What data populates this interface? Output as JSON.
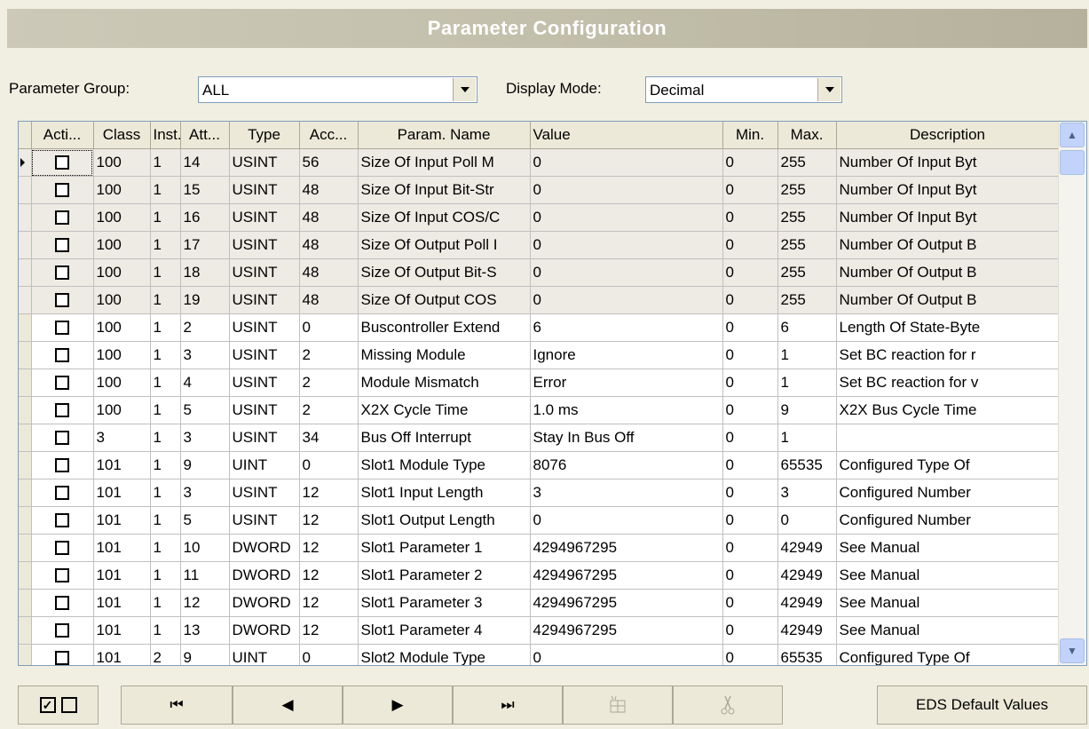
{
  "title": "Parameter Configuration",
  "controls": {
    "group_label": "Parameter Group:",
    "group_value": "ALL",
    "mode_label": "Display Mode:",
    "mode_value": "Decimal"
  },
  "columns": [
    "Acti...",
    "Class",
    "Inst...",
    "Att...",
    "Type",
    "Acc...",
    "Param. Name",
    "Value",
    "Min.",
    "Max.",
    "Description"
  ],
  "rows": [
    {
      "class": "100",
      "inst": "1",
      "att": "14",
      "type": "USINT",
      "acc": "56",
      "name": "Size Of Input Poll M",
      "value": "0",
      "min": "0",
      "max": "255",
      "desc": "Number Of Input Byt"
    },
    {
      "class": "100",
      "inst": "1",
      "att": "15",
      "type": "USINT",
      "acc": "48",
      "name": "Size Of Input Bit-Str",
      "value": "0",
      "min": "0",
      "max": "255",
      "desc": "Number Of Input Byt"
    },
    {
      "class": "100",
      "inst": "1",
      "att": "16",
      "type": "USINT",
      "acc": "48",
      "name": "Size Of Input COS/C",
      "value": "0",
      "min": "0",
      "max": "255",
      "desc": "Number Of Input Byt"
    },
    {
      "class": "100",
      "inst": "1",
      "att": "17",
      "type": "USINT",
      "acc": "48",
      "name": "Size Of Output Poll I",
      "value": "0",
      "min": "0",
      "max": "255",
      "desc": "Number Of Output B"
    },
    {
      "class": "100",
      "inst": "1",
      "att": "18",
      "type": "USINT",
      "acc": "48",
      "name": "Size Of Output Bit-S",
      "value": "0",
      "min": "0",
      "max": "255",
      "desc": "Number Of Output B"
    },
    {
      "class": "100",
      "inst": "1",
      "att": "19",
      "type": "USINT",
      "acc": "48",
      "name": "Size Of Output COS",
      "value": "0",
      "min": "0",
      "max": "255",
      "desc": "Number Of Output B"
    },
    {
      "class": "100",
      "inst": "1",
      "att": "2",
      "type": "USINT",
      "acc": "0",
      "name": "Buscontroller Extend",
      "value": "6",
      "min": "0",
      "max": "6",
      "desc": "Length Of State-Byte"
    },
    {
      "class": "100",
      "inst": "1",
      "att": "3",
      "type": "USINT",
      "acc": "2",
      "name": "Missing Module",
      "value": "Ignore",
      "min": "0",
      "max": "1",
      "desc": "Set BC reaction for r"
    },
    {
      "class": "100",
      "inst": "1",
      "att": "4",
      "type": "USINT",
      "acc": "2",
      "name": "Module Mismatch",
      "value": "Error",
      "min": "0",
      "max": "1",
      "desc": "Set BC reaction for v"
    },
    {
      "class": "100",
      "inst": "1",
      "att": "5",
      "type": "USINT",
      "acc": "2",
      "name": "X2X Cycle Time",
      "value": "1.0 ms",
      "min": "0",
      "max": "9",
      "desc": "X2X Bus Cycle Time"
    },
    {
      "class": "3",
      "inst": "1",
      "att": "3",
      "type": "USINT",
      "acc": "34",
      "name": "Bus Off Interrupt",
      "value": "Stay In Bus Off",
      "min": "0",
      "max": "1",
      "desc": ""
    },
    {
      "class": "101",
      "inst": "1",
      "att": "9",
      "type": "UINT",
      "acc": "0",
      "name": "Slot1 Module Type",
      "value": "8076",
      "min": "0",
      "max": "65535",
      "desc": "Configured Type Of"
    },
    {
      "class": "101",
      "inst": "1",
      "att": "3",
      "type": "USINT",
      "acc": "12",
      "name": "Slot1 Input Length",
      "value": "3",
      "min": "0",
      "max": "3",
      "desc": "Configured Number"
    },
    {
      "class": "101",
      "inst": "1",
      "att": "5",
      "type": "USINT",
      "acc": "12",
      "name": "Slot1 Output Length",
      "value": "0",
      "min": "0",
      "max": "0",
      "desc": "Configured Number"
    },
    {
      "class": "101",
      "inst": "1",
      "att": "10",
      "type": "DWORD",
      "acc": "12",
      "name": "Slot1 Parameter 1",
      "value": "4294967295",
      "min": "0",
      "max": "42949",
      "desc": "See Manual"
    },
    {
      "class": "101",
      "inst": "1",
      "att": "11",
      "type": "DWORD",
      "acc": "12",
      "name": "Slot1 Parameter 2",
      "value": "4294967295",
      "min": "0",
      "max": "42949",
      "desc": "See Manual"
    },
    {
      "class": "101",
      "inst": "1",
      "att": "12",
      "type": "DWORD",
      "acc": "12",
      "name": "Slot1 Parameter 3",
      "value": "4294967295",
      "min": "0",
      "max": "42949",
      "desc": "See Manual"
    },
    {
      "class": "101",
      "inst": "1",
      "att": "13",
      "type": "DWORD",
      "acc": "12",
      "name": "Slot1 Parameter 4",
      "value": "4294967295",
      "min": "0",
      "max": "42949",
      "desc": "See Manual"
    },
    {
      "class": "101",
      "inst": "2",
      "att": "9",
      "type": "UINT",
      "acc": "0",
      "name": "Slot2 Module Type",
      "value": "0",
      "min": "0",
      "max": "65535",
      "desc": "Configured Type Of"
    }
  ],
  "highlighted_row_count": 6,
  "buttons": {
    "first": "⏮",
    "prev": "◀",
    "next": "▶",
    "last": "⏭",
    "eds_label": "EDS Default Values"
  },
  "colors": {
    "title_text": "#ffffff",
    "highlight_row": "#eeeae4",
    "scroll_button": "#c1d3fb"
  }
}
